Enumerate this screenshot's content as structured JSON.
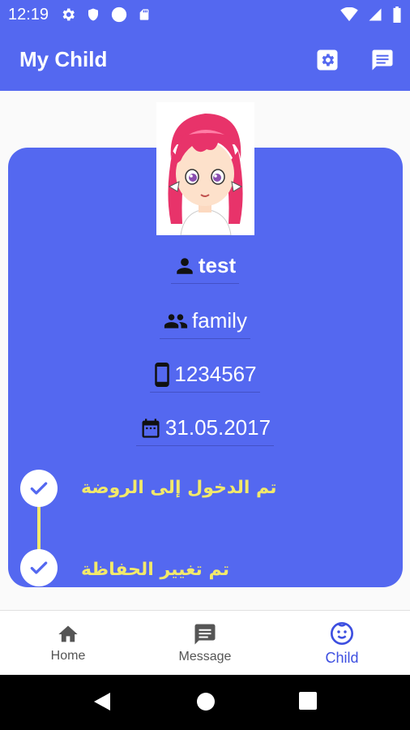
{
  "status_bar": {
    "time": "12:19",
    "icons_left": [
      "gear-icon",
      "shield-icon",
      "circle-icon",
      "sd-card-icon"
    ],
    "icons_right": [
      "wifi-icon",
      "signal-icon",
      "battery-icon"
    ]
  },
  "app_bar": {
    "title": "My Child",
    "actions": [
      "settings-icon",
      "message-icon"
    ]
  },
  "child": {
    "name": "test",
    "group": "family",
    "phone": "1234567",
    "date": "31.05.2017"
  },
  "timeline": [
    {
      "label": "تم الدخول إلى الروضة",
      "done": true
    },
    {
      "label": "تم تغيير الحفاظة",
      "done": true
    }
  ],
  "bottom_nav": {
    "items": [
      {
        "label": "Home",
        "icon": "home-icon"
      },
      {
        "label": "Message",
        "icon": "message-icon"
      },
      {
        "label": "Child",
        "icon": "child-face-icon"
      }
    ],
    "active": "Child"
  },
  "colors": {
    "primary": "#5468f0",
    "accent_text": "#f2e96a",
    "active_nav": "#3d4fe0"
  }
}
